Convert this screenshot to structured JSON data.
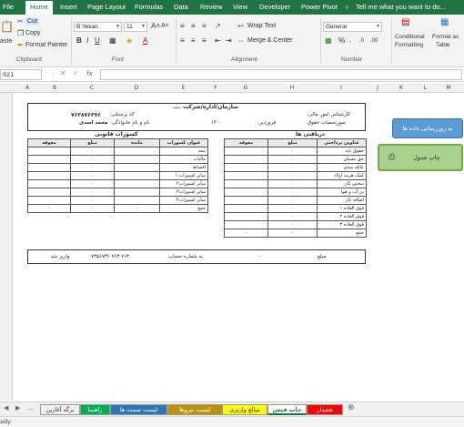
{
  "ribbon_tabs": [
    "File",
    "Home",
    "Insert",
    "Page Layout",
    "Formulas",
    "Data",
    "Review",
    "View",
    "Developer",
    "Power Pivot"
  ],
  "tell_me": "Tell me what you want to do...",
  "tell_me_icon": "lightbulb-icon",
  "clipboard": {
    "paste": "aste",
    "cut": "Cut",
    "copy": "Copy",
    "format_painter": "Format Painter",
    "label": "Clipboard"
  },
  "font": {
    "name": "B Yekan",
    "size": "11",
    "label": "Font"
  },
  "alignment": {
    "wrap": "Wrap Text",
    "merge": "Merge & Center",
    "label": "Alignment"
  },
  "number": {
    "format": "General",
    "label": "Number"
  },
  "styles": {
    "conditional": "Conditional",
    "formatting": "Formatting",
    "format_as": "Format as",
    "table": "Table"
  },
  "formula_bar": {
    "name_box": "021",
    "fx": "fx"
  },
  "columns": [
    "A",
    "B",
    "C",
    "D",
    "E",
    "F",
    "G",
    "H",
    "I",
    "J",
    "K",
    "L",
    "M"
  ],
  "form": {
    "title": "سازمان/اداره/شرکت ....",
    "employee_label": "کد پرسنلی:",
    "employee_code": "۷۶۳۸۷۶۳۷۶",
    "name_label": "نام و نام خانوادگی:",
    "name_value": "محمد اسدی",
    "expert_label": "کارشناس امور مالی",
    "payroll_label": "صورتحساب حقوق:",
    "month": "فروردین",
    "year": "۱۴۰۰",
    "deductions_title": "کسورات قانونی",
    "earnings_title": "دریافتی ها",
    "deduction_headers": [
      "عنوان کسورات",
      "مانده",
      "مبلغ",
      "معوقه"
    ],
    "deductions": [
      "بیمه",
      "مالیات",
      "اقساط",
      "سایر کسورات ۱",
      "سایر کسورات۲",
      "سایر کسورات۳",
      "سایر کسورات۴"
    ],
    "earning_headers": [
      "عناوین پرداختی",
      "مبلغ",
      "معوقه"
    ],
    "earnings": [
      "حقوق پایه",
      "حق مسکن",
      "عائله مندی",
      "کمک هزینه اولاد",
      "سختی کار",
      "بن آب و هوا",
      "اضافه کار",
      "فوق العاده ۱",
      "فوق العاده ۲",
      "فوق العاده ۳"
    ],
    "zero": "۰",
    "dash": "-",
    "total": "جمع",
    "amount_label": "مبلغ",
    "account_label": "به شماره حساب",
    "account_no": "۷۳۵۶۷۳۶ ۷۶۳ ۷۶۳",
    "deposited": "واریز شد."
  },
  "buttons": {
    "data_update": "به روزرسانی داده ها",
    "print_table": "چاپ جدول",
    "print_icon": "printer-icon"
  },
  "sheet_tabs": [
    {
      "label": "برگه آغازین",
      "bg": "#f0f0f0",
      "color": "#333"
    },
    {
      "label": "راهنما",
      "bg": "#00b050",
      "color": "#fff"
    },
    {
      "label": "لیست سمت ها",
      "bg": "#2e75b6",
      "color": "#fff"
    },
    {
      "label": "لیست نیروها",
      "bg": "#bf9000",
      "color": "#fff"
    },
    {
      "label": "مبالغ واریزی",
      "bg": "#ffff00",
      "color": "#333"
    },
    {
      "label": "چاپ فیش",
      "bg": "#ffffff",
      "color": "#217346"
    },
    {
      "label": "هشدار",
      "bg": "#ff0000",
      "color": "#fff"
    }
  ],
  "status": "ady",
  "colors": {
    "excel_green": "#217346",
    "button_blue": "#5b9bd5",
    "button_green": "#a9d08e"
  }
}
